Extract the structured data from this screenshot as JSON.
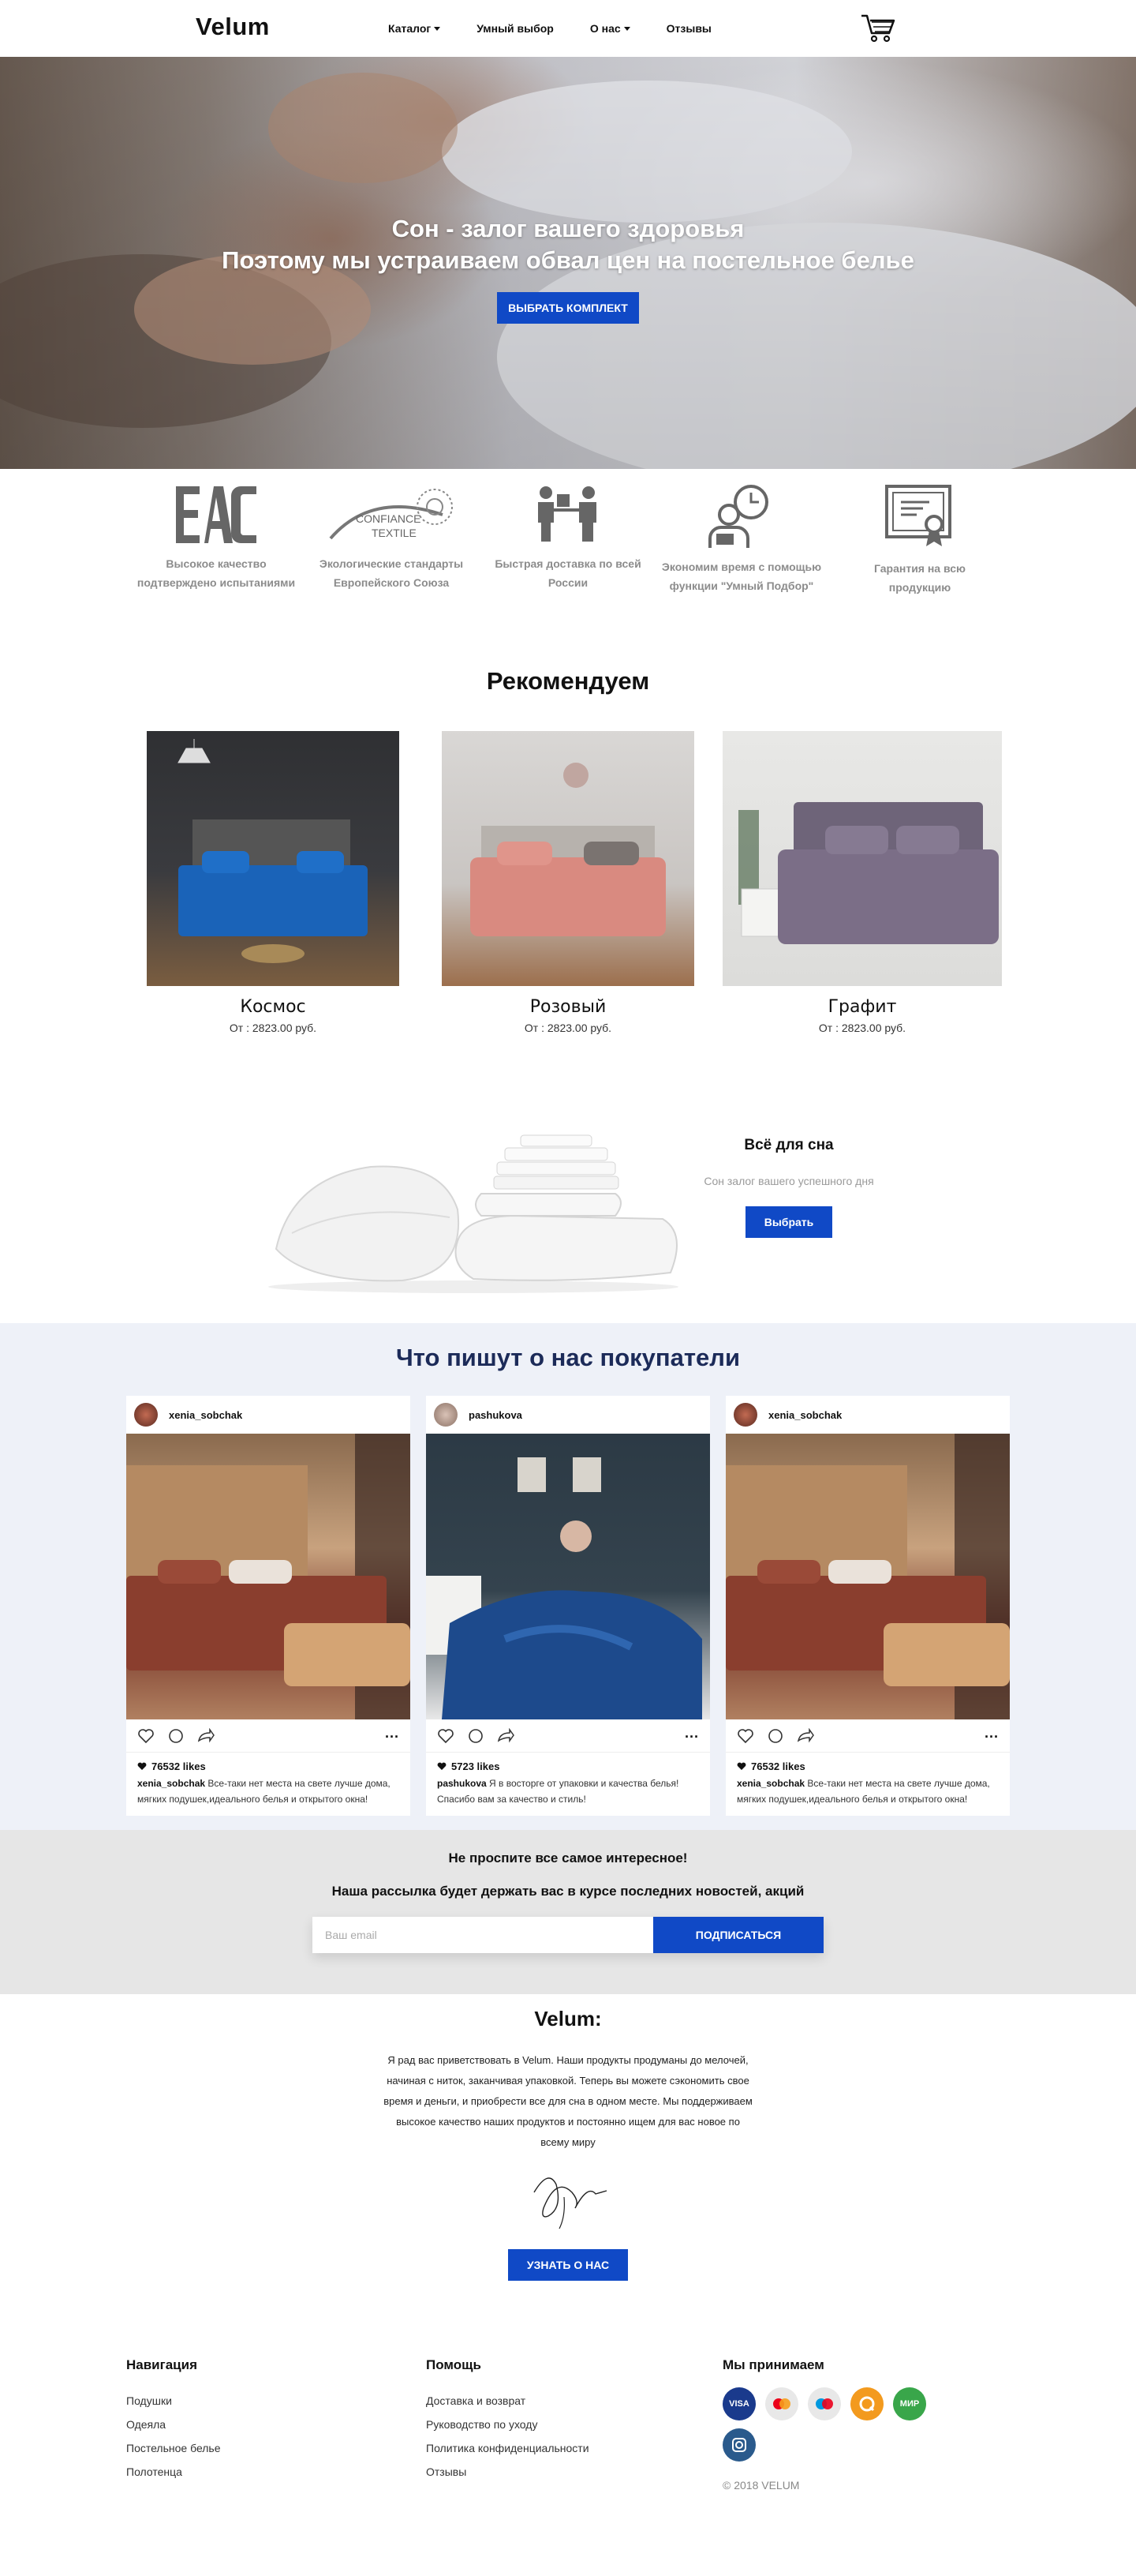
{
  "header": {
    "logo": "Velum",
    "nav": [
      {
        "label": "Каталог",
        "dropdown": true
      },
      {
        "label": "Умный выбор",
        "dropdown": false
      },
      {
        "label": "О нас",
        "dropdown": true
      },
      {
        "label": "Отзывы",
        "dropdown": false
      }
    ],
    "cart_icon": "cart-icon"
  },
  "hero": {
    "title": "Сон - залог вашего здоровья",
    "subtitle": "Поэтому мы устраиваем обвал цен на постельное белье",
    "button": "ВЫБРАТЬ КОМПЛЕКТ"
  },
  "features": [
    {
      "icon": "eac-icon",
      "text_1": "Высокое качество",
      "text_2": "подтверждено испытаниями"
    },
    {
      "icon": "confiance-textile-icon",
      "logo_text_1": "CONFIANCE",
      "logo_text_2": "TEXTILE",
      "text_1": "Экологические стандарты",
      "text_2": "Европейского Союза"
    },
    {
      "icon": "delivery-icon",
      "text_1": "Быстрая доставка по всей",
      "text_2": "России"
    },
    {
      "icon": "time-saving-icon",
      "text_1": "Экономим время с помощью",
      "text_2": "функции \"Умный Подбор\""
    },
    {
      "icon": "certificate-icon",
      "text_1": "Гарантия на всю",
      "text_2": "продукцию"
    }
  ],
  "recommend": {
    "title": "Рекомендуем",
    "products": [
      {
        "name": "Космос",
        "price": "От : 2823.00 руб.",
        "color": "#1a63b8"
      },
      {
        "name": "Розовый",
        "price": "От : 2823.00 руб.",
        "color": "#d98a80"
      },
      {
        "name": "Графит",
        "price": "От : 2823.00 руб.",
        "color": "#7b6e87"
      }
    ]
  },
  "promo": {
    "title": "Всё для сна",
    "subtitle": "Сон залог вашего успешного дня",
    "button": "Выбрать"
  },
  "reviews": {
    "title": "Что пишут о нас покупатели",
    "cards": [
      {
        "user": "xenia_sobchak",
        "likes": "76532 likes",
        "comment_user": "xenia_sobchak",
        "comment_1": "Все-таки нет места на свете лучше дома,",
        "comment_2": "мягких подушек,идеального белья и открытого окна!"
      },
      {
        "user": "pashukova",
        "likes": "5723 likes",
        "comment_user": "pashukova",
        "comment_1": "Я в восторге от упаковки и качества белья!",
        "comment_2": "Спасибо вам за качество и стиль!"
      },
      {
        "user": "xenia_sobchak",
        "likes": "76532 likes",
        "comment_user": "xenia_sobchak",
        "comment_1": "Все-таки нет места на свете лучше дома,",
        "comment_2": "мягких подушек,идеального белья и открытого окна!"
      }
    ]
  },
  "newsletter": {
    "title": "Не проспите все самое интересное!",
    "subtitle": "Наша рассылка будет держать вас в курсе последних новостей, акций",
    "placeholder": "Ваш email",
    "button": "ПОДПИСАТЬСЯ"
  },
  "about": {
    "title": "Velum:",
    "text": "Я рад вас приветствовать в Velum. Наши продукты продуманы до мелочей, начиная с ниток, заканчивая упаковкой. Теперь вы можете сэкономить свое время и деньги, и приобрести все для сна в одном месте. Мы поддерживаем высокое качество наших продуктов и постоянно ищем для вас новое по всему миру",
    "button": "УЗНАТЬ О НАС"
  },
  "footer": {
    "nav_title": "Навигация",
    "nav_items": [
      "Подушки",
      "Одеяла",
      "Постельное белье",
      "Полотенца"
    ],
    "help_title": "Помощь",
    "help_items": [
      "Доставка и возврат",
      "Руководство по уходу",
      "Политика конфиденциальности",
      "Отзывы"
    ],
    "pay_title": "Мы принимаем",
    "payments": [
      {
        "name": "visa-icon",
        "label": "VISA",
        "color": "#1a3a8c"
      },
      {
        "name": "mastercard-icon",
        "label": "",
        "color": "#e8e8e8"
      },
      {
        "name": "maestro-icon",
        "label": "",
        "color": "#e8e8e8"
      },
      {
        "name": "qiwi-icon",
        "label": "",
        "color": "#f39a1e"
      },
      {
        "name": "mir-icon",
        "label": "МИР",
        "color": "#39a64a"
      },
      {
        "name": "instagram-icon",
        "label": "",
        "color": "#2a5a8c"
      }
    ],
    "copyright": "© 2018 VELUM"
  }
}
